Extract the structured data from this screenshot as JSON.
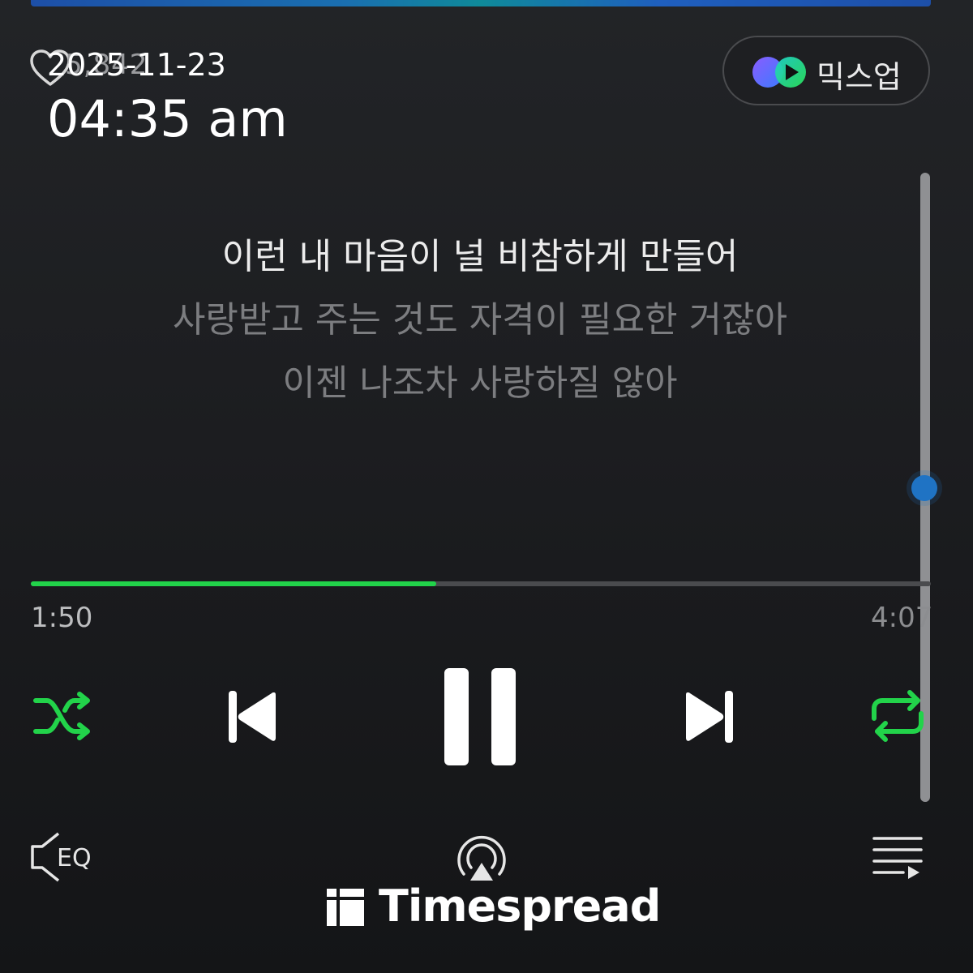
{
  "header": {
    "like_count": "5,842",
    "mixup_label": "믹스업"
  },
  "timestamp": {
    "date": "2025-11-23",
    "time": "04:35 am"
  },
  "lyrics": {
    "current": "이런 내 마음이 널 비참하게 만들어",
    "next": "사랑받고 주는 것도 자격이 필요한 거잖아",
    "after": "이젠 나조차 사랑하질 않아"
  },
  "player": {
    "elapsed": "1:50",
    "total": "4:07",
    "progress_fraction": 0.45,
    "state": "playing",
    "shuffle": "on",
    "repeat": "all"
  },
  "bottom_bar": {
    "eq_label": "EQ"
  },
  "watermark": {
    "text": "Timespread"
  },
  "colors": {
    "accent_green": "#22d34a",
    "scroll_knob": "#1f73c4",
    "background": "#1c1d20",
    "lyric_dim": "#7c7d80"
  },
  "icons": {
    "heart": "heart-outline-icon",
    "mixup": "mixup-logo-icon",
    "shuffle": "shuffle-icon",
    "previous": "skip-previous-icon",
    "pause": "pause-icon",
    "next": "skip-next-icon",
    "repeat": "repeat-icon",
    "eq": "eq-speaker-icon",
    "cast": "airplay-icon",
    "queue": "playlist-icon"
  }
}
